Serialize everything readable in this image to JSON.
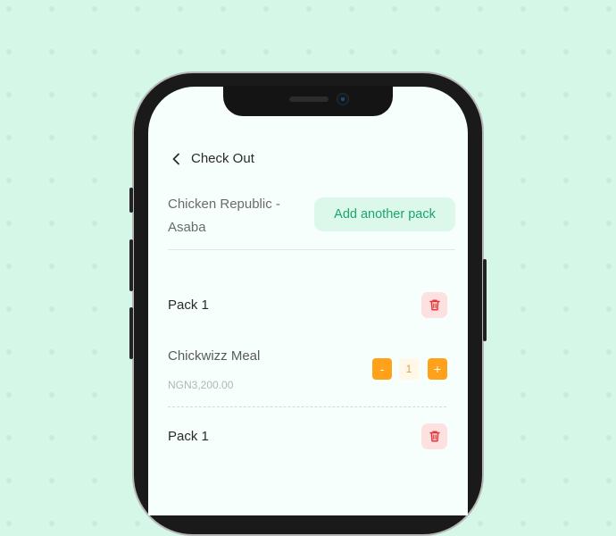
{
  "header": {
    "title": "Check Out",
    "back_icon": "chevron-left-icon"
  },
  "restaurant": {
    "name": "Chicken Republic - Asaba"
  },
  "add_pack_label": "Add another pack",
  "packs": [
    {
      "label": "Pack 1",
      "items": [
        {
          "name": "Chickwizz Meal",
          "price": "NGN3,200.00",
          "quantity": "1",
          "decrement_label": "-",
          "increment_label": "+"
        }
      ]
    },
    {
      "label": "Pack 1"
    }
  ],
  "icons": {
    "delete": "trash-icon"
  },
  "colors": {
    "accent_green": "#1aa66a",
    "accent_green_bg": "#dcf8eb",
    "stepper_orange": "#ffa21a",
    "trash_red": "#e5383b",
    "trash_bg": "#fde1e1",
    "page_bg": "#d5f7e7"
  }
}
